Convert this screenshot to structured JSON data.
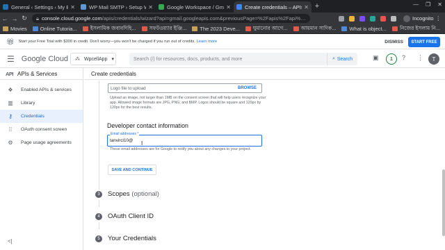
{
  "browser": {
    "tabs": [
      {
        "title": "General ‹ Settings ‹ My Bl…",
        "color": "#2271b1"
      },
      {
        "title": "WP Mail SMTP › Setup Wi…",
        "color": "#5c9ad6"
      },
      {
        "title": "Google Workspace / Gma…",
        "color": "#34a853"
      },
      {
        "title": "Create credentials – APIs…",
        "color": "#4285f4"
      }
    ],
    "active_tab": 3,
    "new_tab": "+",
    "url_host": "console.cloud.google.com",
    "url_path": "/apis/credentials/wizard?api=gmail.googleapis.com&previousPage=%2Fapis%2Fapi%…",
    "incognito_label": "Incognito",
    "bookmarks": [
      "Movies",
      "Online Tutoria...",
      "ইসলামিক জবাবদিহি...",
      "সফটওয়্যার ইঞ্জি...",
      "The 2023 Deve...",
      "ঘুমানোর আগে...",
      "আয়মান সাদিক...",
      "What is object...",
      "নিজের ইসলাম নি..."
    ]
  },
  "banner": {
    "text": "Start your Free Trial with $300 in credit. Don't worry—you won't be charged if you run out of credits.",
    "link": "Learn more",
    "dismiss": "DISMISS",
    "start": "START FREE"
  },
  "header": {
    "logo_google": "Google",
    "logo_cloud": "Cloud",
    "project": "WpcellApp",
    "search_placeholder": "Search (/) for resources, docs, products, and more",
    "search_button": "Search",
    "notif_count": "1",
    "avatar": "T"
  },
  "sidebar": {
    "api_glyph": "API",
    "title": "APIs & Services",
    "items": [
      {
        "label": "Enabled APIs & services",
        "icon": "diamond-icon"
      },
      {
        "label": "Library",
        "icon": "library-icon"
      },
      {
        "label": "Credentials",
        "icon": "key-icon"
      },
      {
        "label": "OAuth consent screen",
        "icon": "consent-icon"
      },
      {
        "label": "Page usage agreements",
        "icon": "settings-icon"
      }
    ],
    "active_index": 2,
    "collapse": "<|"
  },
  "main": {
    "title": "Create credentials",
    "logo_field_placeholder": "Logo file to upload",
    "browse": "BROWSE",
    "logo_help": "Upload an image, not larger than 1MB on the consent screen that will help users recognize your app. Allowed image formats are JPG, PNG, and BMP. Logos should be square and 120px by 120px for the best results.",
    "section_title": "Developer contact information",
    "email_label": "Email addresses *",
    "email_value": "tanvircl10@",
    "email_help": "These email addresses are for Google to notify you about any changes to your project.",
    "save_button": "SAVE AND CONTINUE",
    "steps": [
      {
        "num": "3",
        "label": "Scopes",
        "optional": "(optional)"
      },
      {
        "num": "4",
        "label": "OAuth Client ID",
        "optional": ""
      },
      {
        "num": "5",
        "label": "Your Credentials",
        "optional": ""
      }
    ]
  }
}
